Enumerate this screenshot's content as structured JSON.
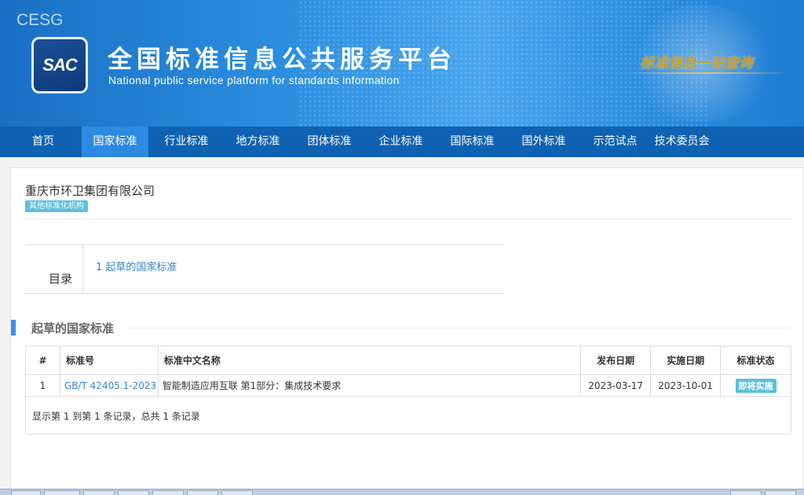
{
  "header": {
    "cesg": "CESG",
    "logo_text": "SAC",
    "title_cn": "全国标准信息公共服务平台",
    "title_en": "National public service platform  for standards information",
    "slogan": "标准信息一站查询"
  },
  "nav": {
    "items": [
      {
        "label": "首页"
      },
      {
        "label": "国家标准"
      },
      {
        "label": "行业标准"
      },
      {
        "label": "地方标准"
      },
      {
        "label": "团体标准"
      },
      {
        "label": "企业标准"
      },
      {
        "label": "国际标准"
      },
      {
        "label": "国外标准"
      },
      {
        "label": "示范试点"
      },
      {
        "label": "技术委员会"
      }
    ],
    "active_index": 1
  },
  "org": {
    "name": "重庆市环卫集团有限公司",
    "tag": "其他标准化机构"
  },
  "toc": {
    "label": "目录",
    "link": "1  起草的国家标准"
  },
  "section": {
    "title": "起草的国家标准"
  },
  "table": {
    "headers": [
      "#",
      "标准号",
      "标准中文名称",
      "发布日期",
      "实施日期",
      "标准状态"
    ],
    "rows": [
      {
        "num": "1",
        "std_no": "GB/T 42405.1-2023",
        "name": "智能制造应用互联 第1部分：集成技术要求",
        "publish": "2023-03-17",
        "implement": "2023-10-01",
        "status": "即将实施"
      }
    ],
    "summary": "显示第 1 到第 1 条记录，总共 1 条记录"
  },
  "colors": {
    "nav_bg": "#0f62b1",
    "nav_active": "#2c8ae2",
    "link": "#3a86c8",
    "badge": "#5bc0de"
  }
}
